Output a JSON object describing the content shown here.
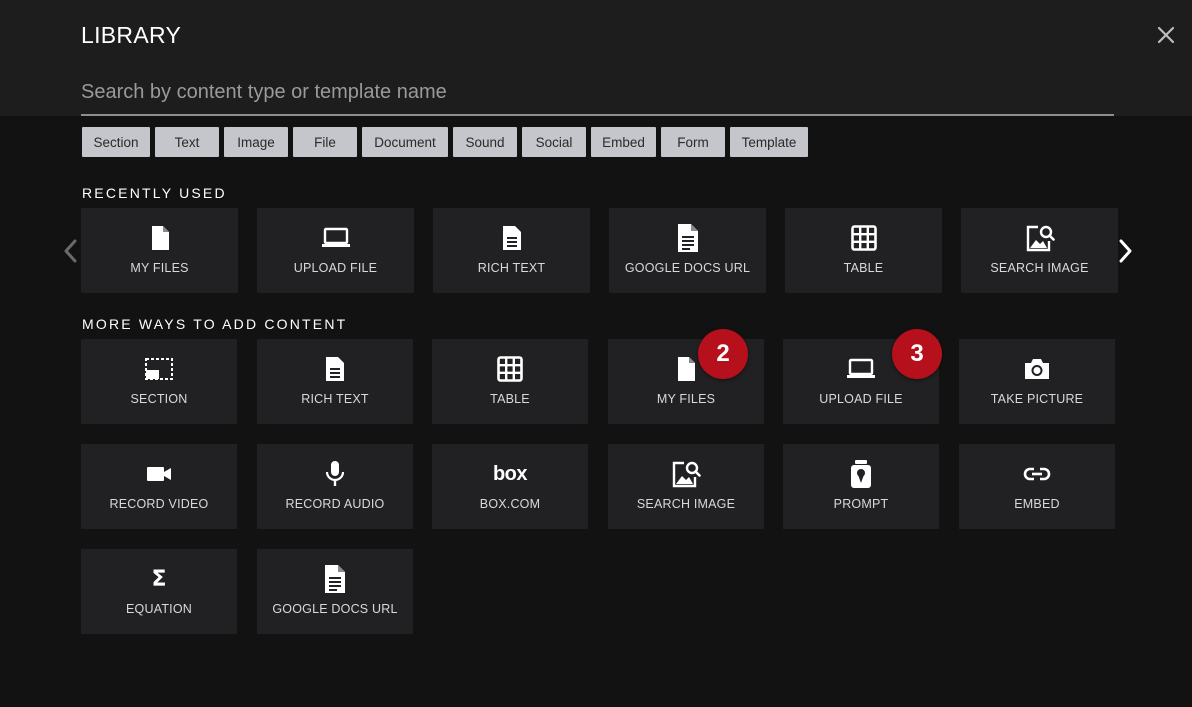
{
  "header": {
    "title": "LIBRARY",
    "search_placeholder": "Search by content type or template name"
  },
  "filters": [
    "Section",
    "Text",
    "Image",
    "File",
    "Document",
    "Sound",
    "Social",
    "Embed",
    "Form",
    "Template"
  ],
  "recent": {
    "label": "RECENTLY USED",
    "items": [
      {
        "label": "MY FILES",
        "icon": "file-icon"
      },
      {
        "label": "UPLOAD FILE",
        "icon": "laptop-icon"
      },
      {
        "label": "RICH TEXT",
        "icon": "document-icon"
      },
      {
        "label": "GOOGLE DOCS URL",
        "icon": "google-doc-icon"
      },
      {
        "label": "TABLE",
        "icon": "table-icon"
      },
      {
        "label": "SEARCH IMAGE",
        "icon": "image-search-icon"
      }
    ]
  },
  "more": {
    "label": "MORE WAYS TO ADD CONTENT",
    "items": [
      {
        "label": "SECTION",
        "icon": "section-icon"
      },
      {
        "label": "RICH TEXT",
        "icon": "document-icon"
      },
      {
        "label": "TABLE",
        "icon": "table-icon"
      },
      {
        "label": "MY FILES",
        "icon": "file-icon"
      },
      {
        "label": "UPLOAD FILE",
        "icon": "laptop-icon"
      },
      {
        "label": "TAKE PICTURE",
        "icon": "camera-icon"
      },
      {
        "label": "RECORD VIDEO",
        "icon": "video-camera-icon"
      },
      {
        "label": "RECORD AUDIO",
        "icon": "microphone-icon"
      },
      {
        "label": "BOX.COM",
        "icon": "box-logo-icon"
      },
      {
        "label": "SEARCH IMAGE",
        "icon": "image-search-icon"
      },
      {
        "label": "PROMPT",
        "icon": "prompt-icon"
      },
      {
        "label": "EMBED",
        "icon": "link-icon"
      },
      {
        "label": "EQUATION",
        "icon": "sigma-icon"
      },
      {
        "label": "GOOGLE DOCS URL",
        "icon": "google-doc-icon"
      }
    ]
  },
  "annotations": [
    {
      "text": "2",
      "color": "#b5101c"
    },
    {
      "text": "3",
      "color": "#b5101c"
    }
  ],
  "box_logo_text": "box",
  "sigma_glyph": "Σ"
}
